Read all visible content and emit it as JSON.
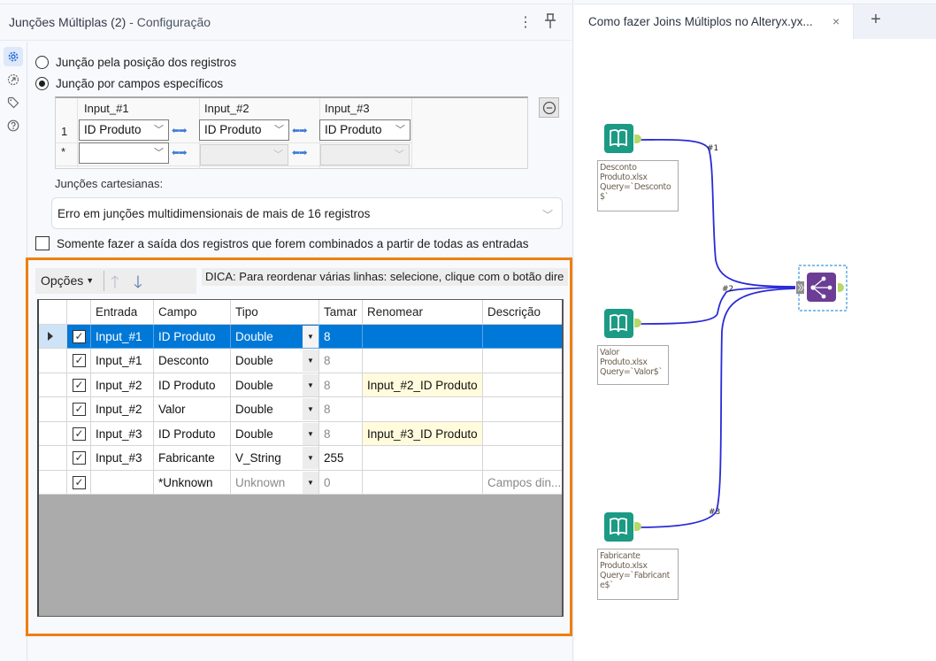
{
  "panel": {
    "title_tool": "Junções Múltiplas (2)",
    "title_sep": " - ",
    "title_section": "Configuração",
    "more_icon": "⋮",
    "pin_icon": "pin-icon"
  },
  "side_rail": [
    {
      "name": "configuration",
      "icon": "gear-icon",
      "active": true
    },
    {
      "name": "annotation",
      "icon": "annotation-icon",
      "active": false
    },
    {
      "name": "tag",
      "icon": "tag-icon",
      "active": false
    },
    {
      "name": "help",
      "icon": "help-icon",
      "active": false
    }
  ],
  "join_mode": {
    "option_position": "Junção pela posição dos registros",
    "option_fields": "Junção por campos específicos",
    "selected": "fields"
  },
  "join_grid": {
    "headers": [
      "Input_#1",
      "Input_#2",
      "Input_#3"
    ],
    "rows": [
      {
        "num": "1",
        "values": [
          "ID Produto",
          "ID Produto",
          "ID Produto"
        ]
      },
      {
        "num": "*",
        "values": [
          "",
          "",
          ""
        ]
      }
    ]
  },
  "cartesian": {
    "label": "Junções cartesianas:",
    "selected": "Erro em junções multidimensionais de mais de 16 registros"
  },
  "only_matched": {
    "label": "Somente fazer a saída dos registros que forem combinados a partir de todas as entradas",
    "checked": false
  },
  "toolbar": {
    "options_label": "Opções",
    "tip": "DICA: Para reordenar várias linhas: selecione, clique com o botão dire"
  },
  "field_table": {
    "columns": [
      "",
      "Entrada",
      "Campo",
      "Tipo",
      "Tamar",
      "Renomear",
      "Descrição"
    ],
    "rows": [
      {
        "selected": true,
        "checked": true,
        "entrada": "Input_#1",
        "campo": "ID Produto",
        "tipo": "Double",
        "tamanho": "8",
        "renomear": "",
        "descricao": ""
      },
      {
        "selected": false,
        "checked": true,
        "entrada": "Input_#1",
        "campo": "Desconto",
        "tipo": "Double",
        "tamanho": "8",
        "renomear": "",
        "descricao": ""
      },
      {
        "selected": false,
        "checked": true,
        "entrada": "Input_#2",
        "campo": "ID Produto",
        "tipo": "Double",
        "tamanho": "8",
        "renomear": "Input_#2_ID Produto",
        "descricao": ""
      },
      {
        "selected": false,
        "checked": true,
        "entrada": "Input_#2",
        "campo": "Valor",
        "tipo": "Double",
        "tamanho": "8",
        "renomear": "",
        "descricao": ""
      },
      {
        "selected": false,
        "checked": true,
        "entrada": "Input_#3",
        "campo": "ID Produto",
        "tipo": "Double",
        "tamanho": "8",
        "renomear": "Input_#3_ID Produto",
        "descricao": ""
      },
      {
        "selected": false,
        "checked": true,
        "entrada": "Input_#3",
        "campo": "Fabricante",
        "tipo": "V_String",
        "tamanho": "255",
        "renomear": "",
        "descricao": ""
      },
      {
        "selected": false,
        "checked": true,
        "entrada": "",
        "campo": "*Unknown",
        "tipo": "Unknown",
        "tamanho": "0",
        "renomear": "",
        "descricao": "Campos din..."
      }
    ]
  },
  "workflow_tab": {
    "title": "Como fazer Joins Múltiplos no Alteryx.yx...",
    "close": "×",
    "add": "+"
  },
  "workflow": {
    "nodes": [
      {
        "type": "input",
        "label": [
          "Desconto",
          "Produto.xlsx",
          "Query=`Desconto",
          "$`"
        ]
      },
      {
        "type": "input",
        "label": [
          "Valor",
          "Produto.xlsx",
          "Query=`Valor$`"
        ]
      },
      {
        "type": "input",
        "label": [
          "Fabricante",
          "Produto.xlsx",
          "Query=`Fabricant",
          "e$`"
        ]
      },
      {
        "type": "join-multiple",
        "label": []
      }
    ],
    "connections": [
      "#1",
      "#2",
      "#3"
    ],
    "colors": {
      "input": "#1b9a84",
      "join": "#6b3d94",
      "connection": "#2a2ad8",
      "anchor": "#b7d86a",
      "selection": "#3a96dd"
    }
  },
  "accent": {
    "highlight": "#ee7f13",
    "selection": "#0078d7"
  }
}
